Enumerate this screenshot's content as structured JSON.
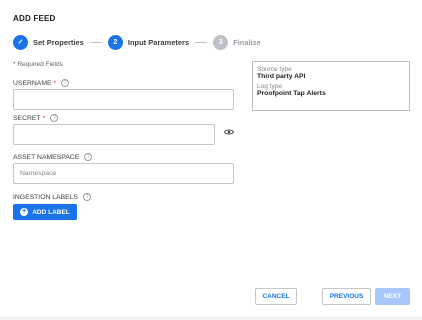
{
  "dialog": {
    "title": "ADD FEED"
  },
  "stepper": {
    "steps": [
      {
        "number": "✓",
        "label": "Set Properties",
        "state": "done"
      },
      {
        "number": "2",
        "label": "Input Parameters",
        "state": "active"
      },
      {
        "number": "3",
        "label": "Finalize",
        "state": "todo"
      }
    ]
  },
  "form": {
    "required_note": "* Required Fields",
    "username": {
      "label": "USERNAME",
      "required": "*",
      "value": ""
    },
    "secret": {
      "label": "SECRET",
      "required": "*",
      "value": ""
    },
    "namespace": {
      "label": "ASSET NAMESPACE",
      "placeholder": "Namespace"
    },
    "ingestion": {
      "label": "INGESTION LABELS",
      "button": "ADD LABEL"
    },
    "help_glyph": "?"
  },
  "summary": {
    "source_type_label": "Source type",
    "source_type_value": "Third party API",
    "log_type_label": "Log type",
    "log_type_value": "Proofpoint Tap Alerts"
  },
  "footer": {
    "cancel": "CANCEL",
    "previous": "PREVIOUS",
    "next": "NEXT"
  },
  "colors": {
    "accent": "#1a73e8",
    "disabled": "#a8c7fa",
    "required": "#d93025"
  }
}
